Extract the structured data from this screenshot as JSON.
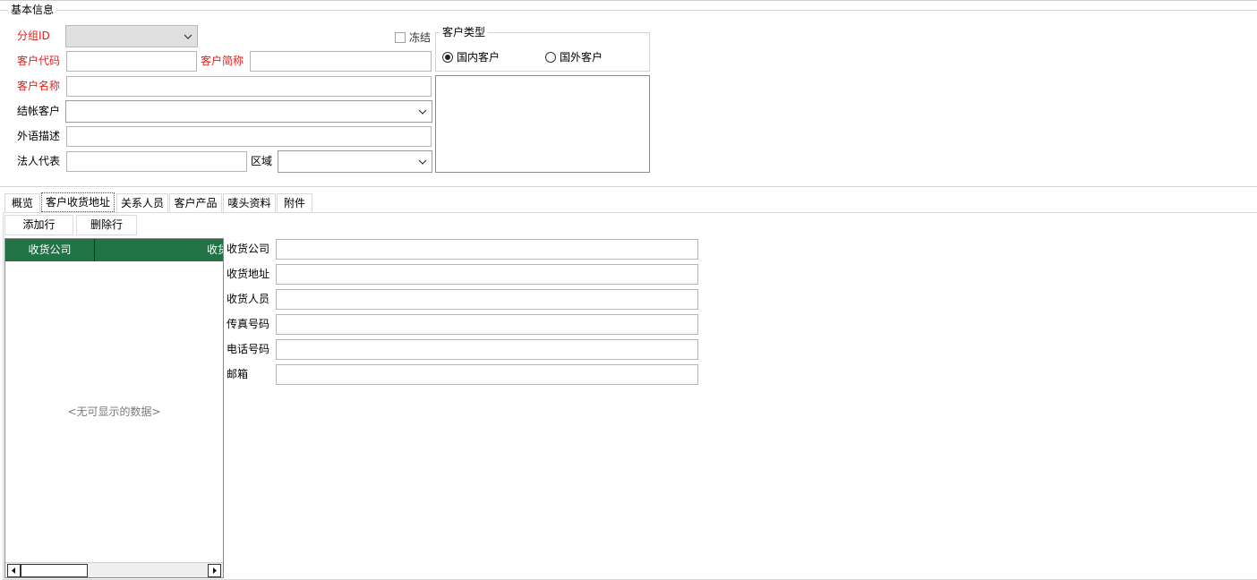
{
  "basic": {
    "title": "基本信息",
    "group_id_label": "分组ID",
    "freeze_label": "冻结",
    "customer_code_label": "客户代码",
    "customer_short_label": "客户简称",
    "customer_name_label": "客户名称",
    "settle_customer_label": "结帐客户",
    "foreign_desc_label": "外语描述",
    "legal_rep_label": "法人代表",
    "region_label": "区域",
    "customer_type": {
      "title": "客户类型",
      "options": [
        {
          "label": "国内客户",
          "selected": true
        },
        {
          "label": "国外客户",
          "selected": false
        }
      ]
    }
  },
  "tabs": [
    {
      "label": "概览",
      "active": false
    },
    {
      "label": "客户收货地址",
      "active": true
    },
    {
      "label": "关系人员",
      "active": false
    },
    {
      "label": "客户产品",
      "active": false
    },
    {
      "label": "唛头资料",
      "active": false
    },
    {
      "label": "附件",
      "active": false
    }
  ],
  "toolbar": {
    "add_row": "添加行",
    "delete_row": "删除行"
  },
  "grid": {
    "columns": [
      "收货公司",
      "收货"
    ],
    "empty_text": "<无可显示的数据>",
    "header_color": "#217346"
  },
  "detail": {
    "fields": [
      {
        "label": "收货公司",
        "value": ""
      },
      {
        "label": "收货地址",
        "value": ""
      },
      {
        "label": "收货人员",
        "value": ""
      },
      {
        "label": "传真号码",
        "value": ""
      },
      {
        "label": "电话号码",
        "value": ""
      },
      {
        "label": "邮箱",
        "value": ""
      }
    ]
  },
  "colors": {
    "required_label": "#e0201b",
    "grid_header": "#217346"
  }
}
